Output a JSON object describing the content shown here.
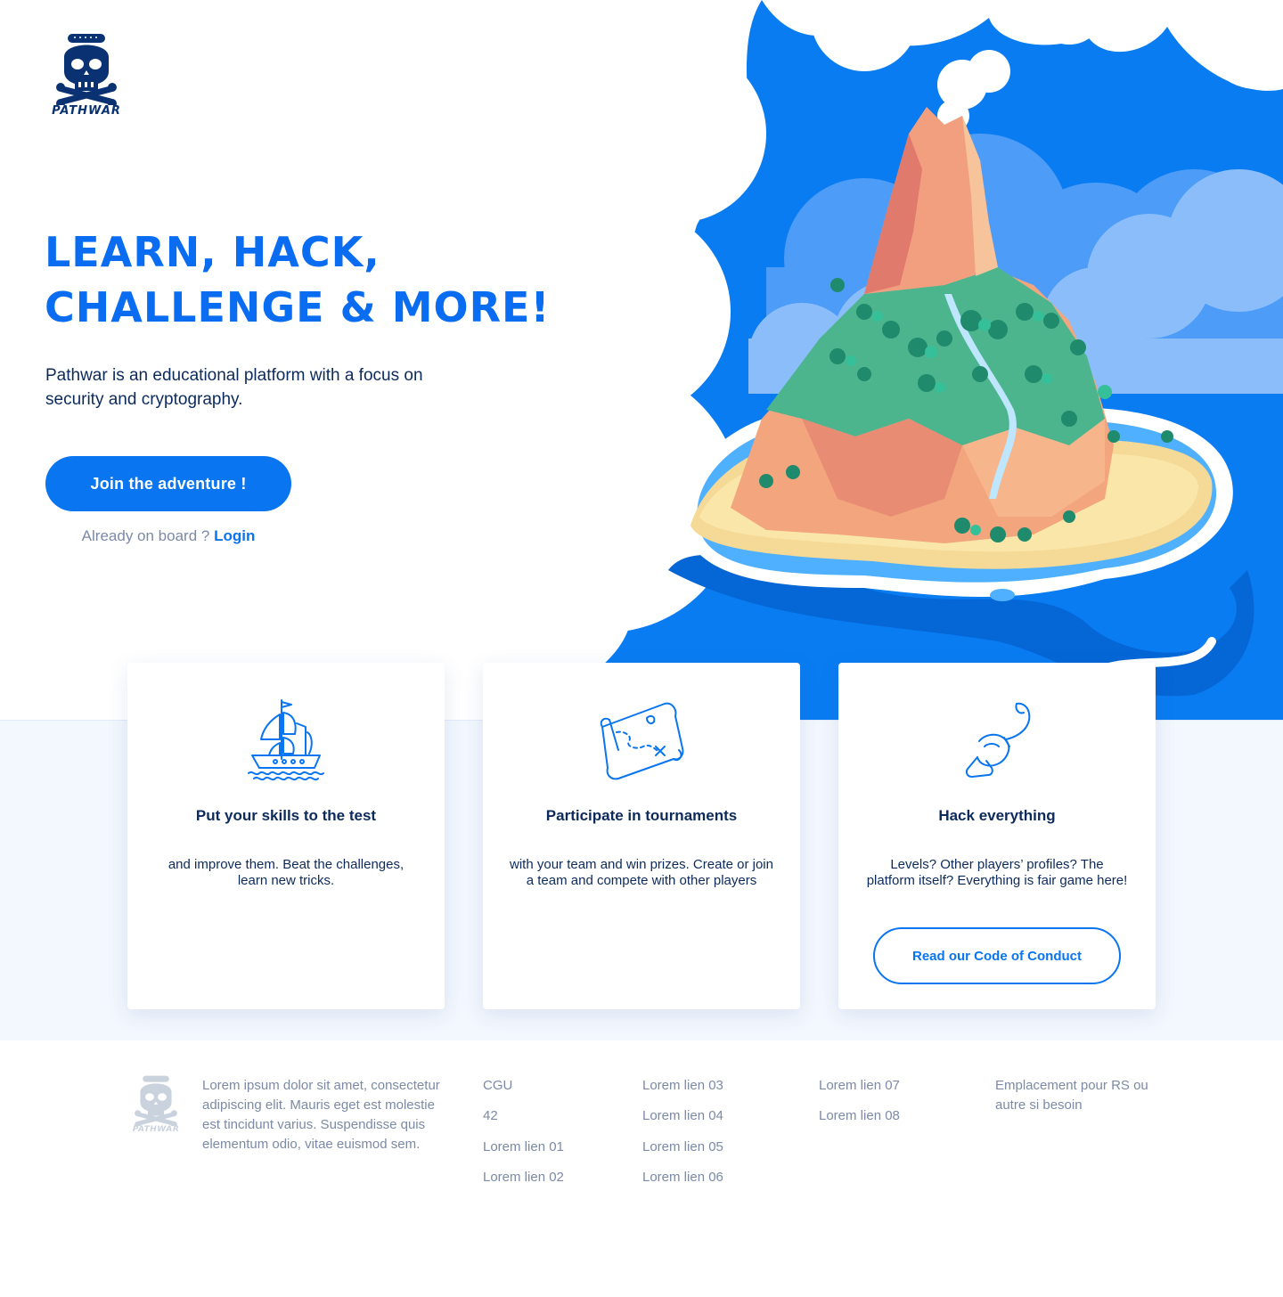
{
  "brand": {
    "name": "PATHWAR",
    "primary_color": "#0a75f0",
    "dark_color": "#0a3272",
    "text_color": "#0d2a5c"
  },
  "hero": {
    "headline_line1": "LEARN, HACK,",
    "headline_line2": "CHALLENGE & MORE!",
    "intro": "Pathwar is an educational platform with a focus on security and cryptography.",
    "cta_label": "Join the adventure !",
    "already_text": "Already on board ?",
    "login_label": "Login",
    "illustration": "island-volcano-illustration"
  },
  "features": [
    {
      "icon": "pirate-ship-icon",
      "title": "Put your skills to the test",
      "text": "and improve them. Beat the challenges, learn new tricks."
    },
    {
      "icon": "treasure-map-icon",
      "title": "Participate in tournaments",
      "text": "with your team and win prizes. Create or join a team and compete with other players"
    },
    {
      "icon": "pirate-hook-icon",
      "title": "Hack everything",
      "text": "Levels? Other players’ profiles? The platform itself? Everything is fair game here!",
      "button_label": "Read our Code of Conduct"
    }
  ],
  "footer": {
    "logo_text": "PATHWAR",
    "description": "Lorem ipsum dolor sit amet, consectetur adipiscing elit. Mauris eget est molestie est tincidunt varius. Suspendisse quis elementum odio, vitae euismod sem.",
    "col1": [
      "CGU",
      "42",
      "Lorem lien 01",
      "Lorem lien 02"
    ],
    "col2": [
      "Lorem lien 03",
      "Lorem lien 04",
      "Lorem lien 05",
      "Lorem lien 06"
    ],
    "col3": [
      "Lorem lien 07",
      "Lorem lien 08"
    ],
    "social_note": "Emplacement pour RS ou autre si besoin"
  }
}
